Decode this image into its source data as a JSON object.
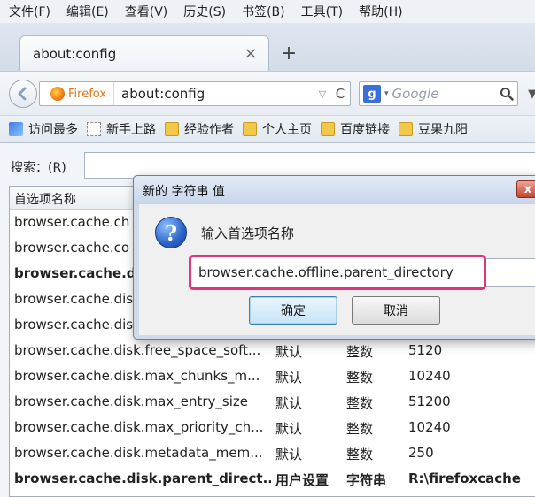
{
  "menubar": {
    "items": [
      "文件(F)",
      "编辑(E)",
      "查看(V)",
      "历史(S)",
      "书签(B)",
      "工具(T)",
      "帮助(H)"
    ]
  },
  "tab": {
    "title": "about:config",
    "close_glyph": "×",
    "new_tab_glyph": "+"
  },
  "navbar": {
    "identity_label": "Firefox",
    "url": "about:config",
    "search_placeholder": "Google",
    "search_engine_letter": "g",
    "url_dropdown_glyph": "▽",
    "reload_glyph": "C",
    "engine_dropdown_glyph": "▾",
    "overflow_glyph": "▼"
  },
  "bookmarks": {
    "items": [
      {
        "label": "访问最多",
        "icon": "mostvisited"
      },
      {
        "label": "新手上路",
        "icon": "blank"
      },
      {
        "label": "经验作者",
        "icon": "folder"
      },
      {
        "label": "个人主页",
        "icon": "folder"
      },
      {
        "label": "百度链接",
        "icon": "folder"
      },
      {
        "label": "豆果九阳",
        "icon": "folder"
      }
    ]
  },
  "config": {
    "search_label": "搜索：(R)",
    "search_value": "",
    "col_name": "首选项名称",
    "rows": [
      {
        "name": "browser.cache.ch",
        "status": "",
        "type": "",
        "value": "",
        "bold": false
      },
      {
        "name": "browser.cache.co",
        "status": "",
        "type": "",
        "value": "",
        "bold": false
      },
      {
        "name": "browser.cache.di",
        "status": "",
        "type": "",
        "value": "",
        "bold": true
      },
      {
        "name": "browser.cache.dis",
        "status": "",
        "type": "",
        "value": "",
        "bold": false
      },
      {
        "name": "browser.cache.dis",
        "status": "",
        "type": "",
        "value": "",
        "bold": false
      },
      {
        "name": "browser.cache.disk.free_space_soft...",
        "status": "默认",
        "type": "整数",
        "value": "5120",
        "bold": false
      },
      {
        "name": "browser.cache.disk.max_chunks_m...",
        "status": "默认",
        "type": "整数",
        "value": "10240",
        "bold": false
      },
      {
        "name": "browser.cache.disk.max_entry_size",
        "status": "默认",
        "type": "整数",
        "value": "51200",
        "bold": false
      },
      {
        "name": "browser.cache.disk.max_priority_ch...",
        "status": "默认",
        "type": "整数",
        "value": "10240",
        "bold": false
      },
      {
        "name": "browser.cache.disk.metadata_mem...",
        "status": "默认",
        "type": "整数",
        "value": "250",
        "bold": false
      },
      {
        "name": "browser.cache.disk.parent_direct...",
        "status": "用户设置",
        "type": "字符串",
        "value": "R:\\firefoxcache",
        "bold": true
      }
    ]
  },
  "dialog": {
    "title": "新的 字符串 值",
    "close_glyph": "x",
    "prompt": "输入首选项名称",
    "input_value": "browser.cache.offline.parent_directory",
    "ok_label": "确定",
    "cancel_label": "取消",
    "question_glyph": "?"
  }
}
